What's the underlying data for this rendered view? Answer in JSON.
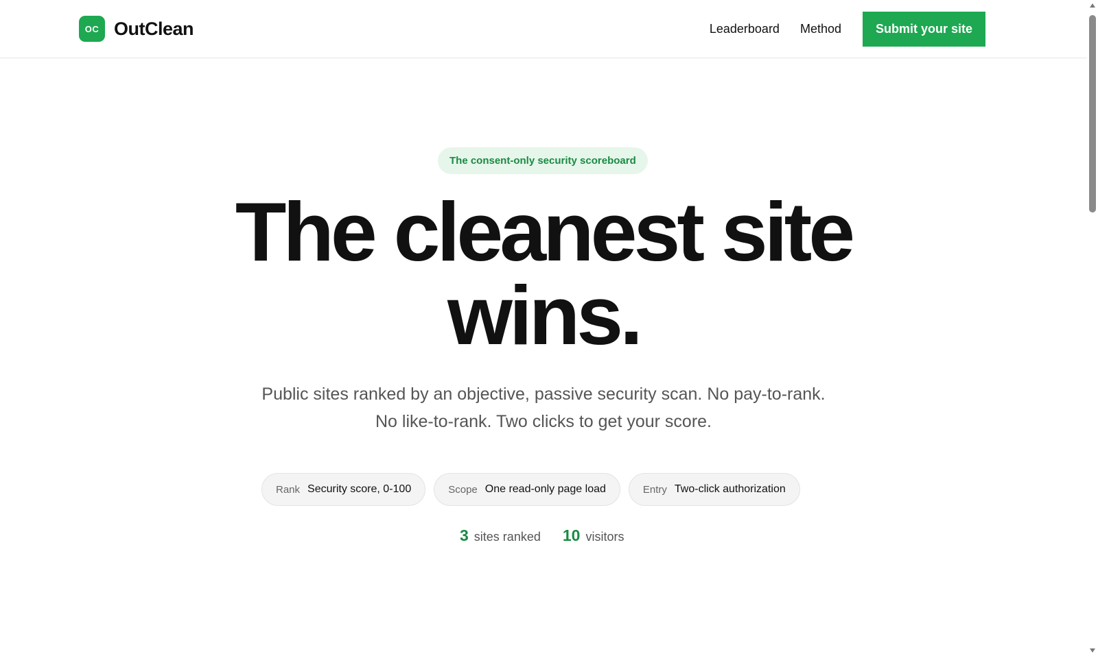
{
  "header": {
    "logo_mark": "OC",
    "brand": "OutClean",
    "nav": [
      "Leaderboard",
      "Method"
    ],
    "cta": "Submit your site"
  },
  "hero": {
    "eyebrow": "The consent-only security scoreboard",
    "headline": "The cleanest site wins.",
    "subhead": "Public sites ranked by an objective, passive security scan. No pay-to-rank. No like-to-rank. Two clicks to get your score.",
    "pills": [
      {
        "key": "Rank",
        "value": "Security score, 0-100"
      },
      {
        "key": "Scope",
        "value": "One read-only page load"
      },
      {
        "key": "Entry",
        "value": "Two-click authorization"
      }
    ],
    "stats": [
      {
        "number": "3",
        "label": "sites ranked"
      },
      {
        "number": "10",
        "label": "visitors"
      }
    ]
  },
  "colors": {
    "accent": "#1da851",
    "accent_text": "#1a8a43",
    "eyebrow_bg": "#e6f6ea"
  }
}
